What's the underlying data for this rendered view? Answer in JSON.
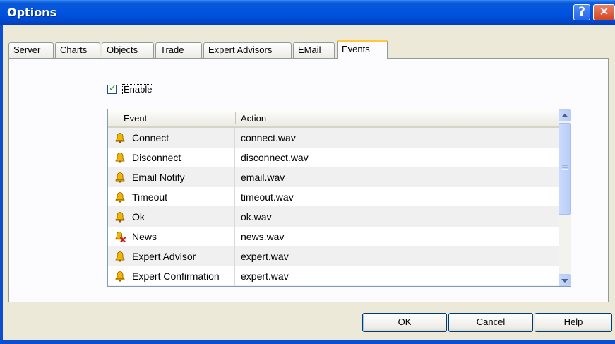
{
  "window": {
    "title": "Options",
    "help_button": "?",
    "close_button": "✕"
  },
  "tabs": [
    {
      "label": "Server",
      "active": false
    },
    {
      "label": "Charts",
      "active": false
    },
    {
      "label": "Objects",
      "active": false
    },
    {
      "label": "Trade",
      "active": false
    },
    {
      "label": "Expert Advisors",
      "active": false
    },
    {
      "label": "EMail",
      "active": false
    },
    {
      "label": "Events",
      "active": true
    }
  ],
  "enable_checkbox": {
    "label": "Enable",
    "checked": true
  },
  "events_table": {
    "columns": [
      "Event",
      "Action"
    ],
    "rows": [
      {
        "event": "Connect",
        "action": "connect.wav",
        "icon": "bell-icon"
      },
      {
        "event": "Disconnect",
        "action": "disconnect.wav",
        "icon": "bell-icon"
      },
      {
        "event": "Email Notify",
        "action": "email.wav",
        "icon": "bell-icon"
      },
      {
        "event": "Timeout",
        "action": "timeout.wav",
        "icon": "bell-icon"
      },
      {
        "event": "Ok",
        "action": "ok.wav",
        "icon": "bell-icon"
      },
      {
        "event": "News",
        "action": "news.wav",
        "icon": "bell-disabled-icon"
      },
      {
        "event": "Expert Advisor",
        "action": "expert.wav",
        "icon": "bell-icon"
      },
      {
        "event": "Expert Confirmation",
        "action": "expert.wav",
        "icon": "bell-icon"
      }
    ]
  },
  "buttons": {
    "ok": "OK",
    "cancel": "Cancel",
    "help": "Help"
  },
  "colors": {
    "titlebar": "#0053e1",
    "tab_highlight": "#ffc73c",
    "bell": "#f0b400",
    "disabled_x": "#d01818"
  }
}
